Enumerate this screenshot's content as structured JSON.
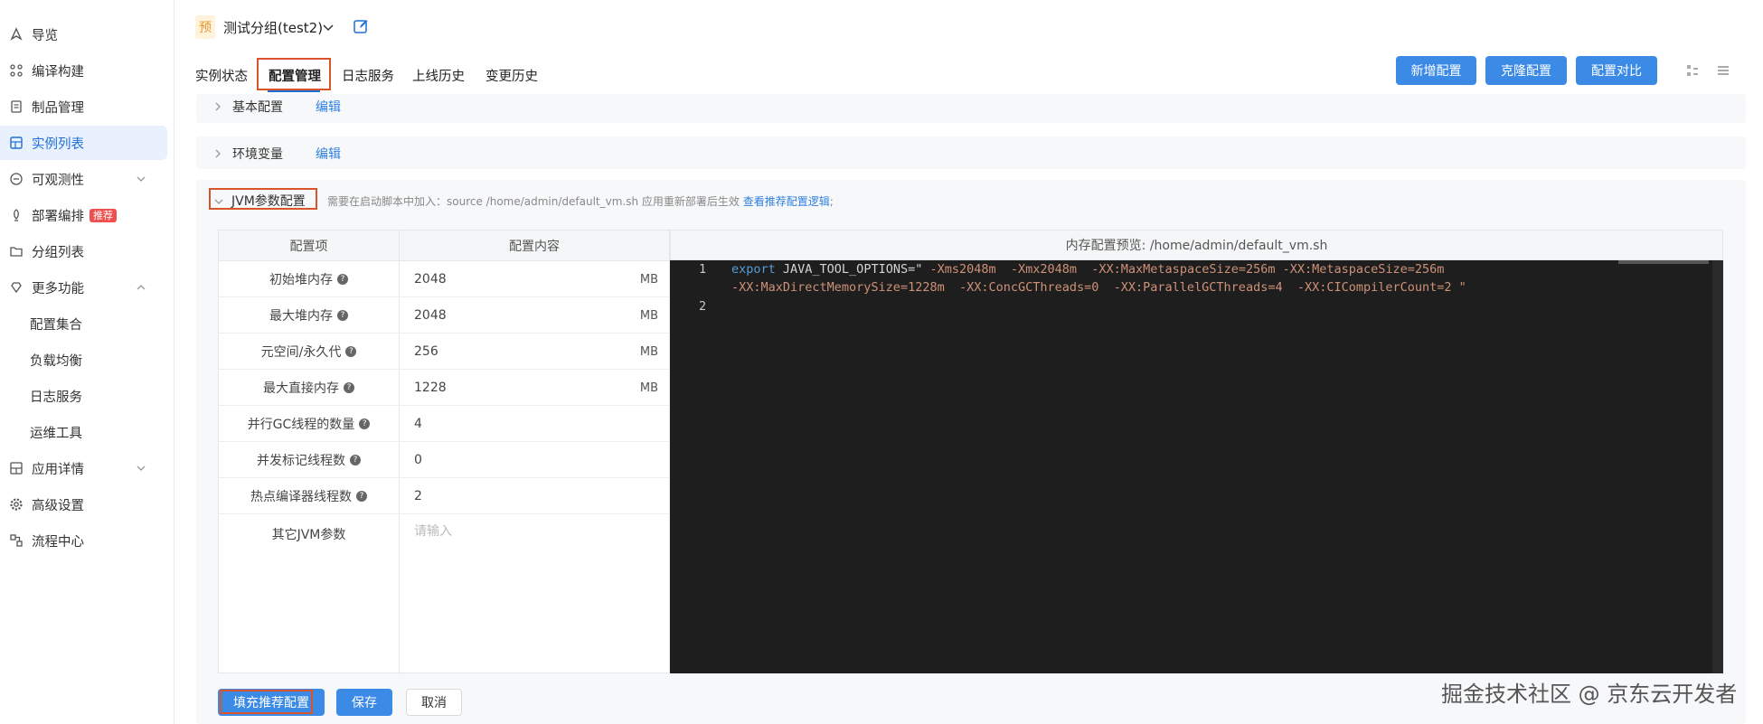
{
  "sidebar": {
    "items": [
      {
        "label": "导览",
        "icon": "navigation-icon"
      },
      {
        "label": "编译构建",
        "icon": "build-icon"
      },
      {
        "label": "制品管理",
        "icon": "artifact-icon"
      },
      {
        "label": "实例列表",
        "icon": "list-icon",
        "active": true
      },
      {
        "label": "可观测性",
        "icon": "monitor-icon"
      },
      {
        "label": "部署编排",
        "icon": "deploy-icon",
        "badge": "推荐"
      },
      {
        "label": "分组列表",
        "icon": "folder-icon"
      },
      {
        "label": "更多功能",
        "icon": "diamond-icon"
      },
      {
        "label": "配置集合"
      },
      {
        "label": "负载均衡"
      },
      {
        "label": "日志服务"
      },
      {
        "label": "运维工具"
      },
      {
        "label": "应用详情",
        "icon": "app-detail-icon"
      },
      {
        "label": "高级设置",
        "icon": "gear-icon"
      },
      {
        "label": "流程中心",
        "icon": "flow-icon"
      }
    ]
  },
  "header": {
    "group_badge": "预",
    "group_title": "测试分组(test2)"
  },
  "tabs": [
    "实例状态",
    "配置管理",
    "日志服务",
    "上线历史",
    "变更历史"
  ],
  "actions": {
    "new_config": "新增配置",
    "clone_config": "克隆配置",
    "compare_config": "配置对比"
  },
  "panels": {
    "basic": {
      "title": "基本配置",
      "edit": "编辑"
    },
    "env": {
      "title": "环境变量",
      "edit": "编辑"
    },
    "jvm": {
      "title": "JVM参数配置",
      "hint": "需要在启动脚本中加入：source /home/admin/default_vm.sh 应用重新部署后生效",
      "hint_link": "查看推荐配置逻辑",
      "hint_tail": ";"
    }
  },
  "table": {
    "col_item": "配置项",
    "col_content": "配置内容",
    "rows": [
      {
        "label": "初始堆内存",
        "value": "2048",
        "unit": "MB"
      },
      {
        "label": "最大堆内存",
        "value": "2048",
        "unit": "MB"
      },
      {
        "label": "元空间/永久代",
        "value": "256",
        "unit": "MB"
      },
      {
        "label": "最大直接内存",
        "value": "1228",
        "unit": "MB"
      },
      {
        "label": "并行GC线程的数量",
        "value": "4",
        "unit": ""
      },
      {
        "label": "并发标记线程数",
        "value": "0",
        "unit": ""
      },
      {
        "label": "热点编译器线程数",
        "value": "2",
        "unit": ""
      },
      {
        "label": "其它JVM参数",
        "placeholder": "请输入"
      }
    ]
  },
  "editor": {
    "title": "内存配置预览: /home/admin/default_vm.sh",
    "line_numbers": [
      "1",
      "2"
    ],
    "line1_kw": "export",
    "line1_var": " JAVA_TOOL_OPTIONS=\"",
    "line1_str": " -Xms2048m  -Xmx2048m  -XX:MaxMetaspaceSize=256m -XX:MetaspaceSize=256m",
    "line1b_str": "-XX:MaxDirectMemorySize=1228m  -XX:ConcGCThreads=0  -XX:ParallelGCThreads=4  -XX:CICompilerCount=2 \""
  },
  "footer": {
    "fill_recommended": "填充推荐配置",
    "save": "保存",
    "cancel": "取消"
  },
  "watermark": "掘金技术社区 @ 京东云开发者"
}
